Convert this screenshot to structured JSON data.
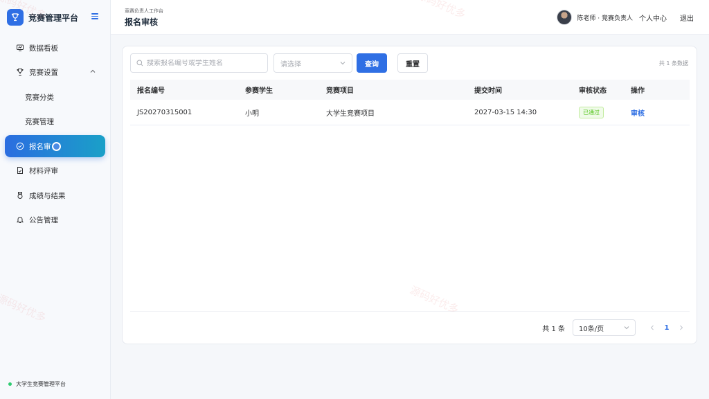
{
  "brand": {
    "title": "竞赛管理平台"
  },
  "sidebar": {
    "items": [
      {
        "label": "数据看板",
        "icon": "dashboard-icon"
      },
      {
        "label": "竞赛设置",
        "icon": "trophy-icon",
        "expanded": true
      },
      {
        "label": "竞赛分类"
      },
      {
        "label": "竞赛管理"
      },
      {
        "label": "报名审",
        "icon": "check-circle-icon",
        "active": true
      },
      {
        "label": "材料评审",
        "icon": "document-check-icon"
      },
      {
        "label": "成绩与结果",
        "icon": "medal-icon"
      },
      {
        "label": "公告管理",
        "icon": "bell-icon"
      }
    ],
    "footer": "大学生竞赛管理平台"
  },
  "header": {
    "subtitle": "竞赛负责人工作台",
    "title": "报名审核",
    "user": "陈老师 · 竞赛负责人",
    "profile_link": "个人中心",
    "logout_link": "退出"
  },
  "toolbar": {
    "search_placeholder": "搜索报名编号或学生姓名",
    "select_placeholder": "请选择",
    "query_label": "查询",
    "reset_label": "重置",
    "total_label": "共 1 条数据"
  },
  "table": {
    "headers": [
      "报名编号",
      "参赛学生",
      "竞赛项目",
      "提交时间",
      "审核状态",
      "操作"
    ],
    "rows": [
      {
        "id": "JS20270315001",
        "student": "小明",
        "project": "大学生竞赛项目",
        "submitted": "2027-03-15 14:30",
        "status": "已通过",
        "action": "审核"
      }
    ]
  },
  "pagination": {
    "total": "共 1 条",
    "page_size": "10条/页",
    "current_page": "1"
  },
  "watermark": "源码好优多",
  "colors": {
    "primary": "#2f6fe4",
    "active_gradient_end": "#1aa0c8",
    "success": "#52c41a",
    "online_dot": "#2ecc71"
  }
}
